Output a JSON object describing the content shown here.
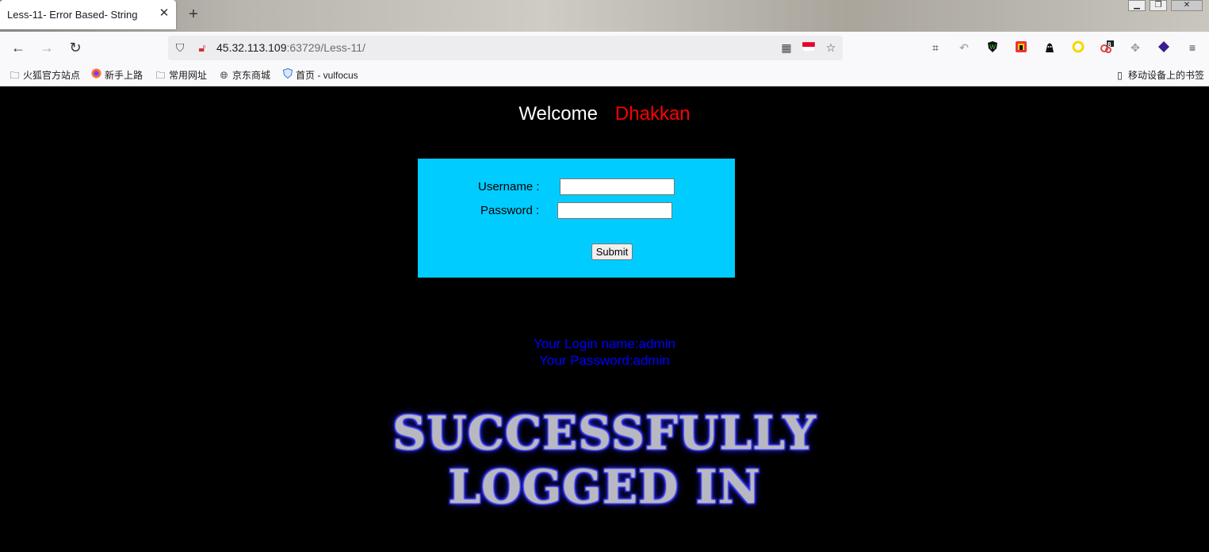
{
  "browser": {
    "tab_title": "Less-11- Error Based- String",
    "tab_close": "✕",
    "new_tab": "+",
    "url_host": "45.32.113.109",
    "url_rest": ":63729/Less-11/",
    "bookmarks": [
      {
        "label": "火狐官方站点",
        "icon": "folder-icon"
      },
      {
        "label": "新手上路",
        "icon": "firefox-icon"
      },
      {
        "label": "常用网址",
        "icon": "folder-icon"
      },
      {
        "label": "京东商城",
        "icon": "globe-icon"
      },
      {
        "label": "首页 - vulfocus",
        "icon": "shield-icon"
      }
    ],
    "mobile_bookmarks": "移动设备上的书签",
    "extension_badge": "8"
  },
  "page": {
    "welcome": "Welcome",
    "username_highlight": "Dhakkan",
    "form": {
      "username_label": "Username :",
      "password_label": "Password :",
      "username_value": "",
      "password_value": "",
      "submit_label": "Submit"
    },
    "result": {
      "login_name": "Your Login name:admin",
      "password": "Your Password:admin"
    },
    "banner": {
      "line1": "SUCCESSFULLY",
      "line2": "LOGGED IN"
    }
  },
  "colors": {
    "page_background": "#000000",
    "form_background": "#00ccff",
    "highlight": "#ff0000",
    "result_text": "#0000ff"
  }
}
